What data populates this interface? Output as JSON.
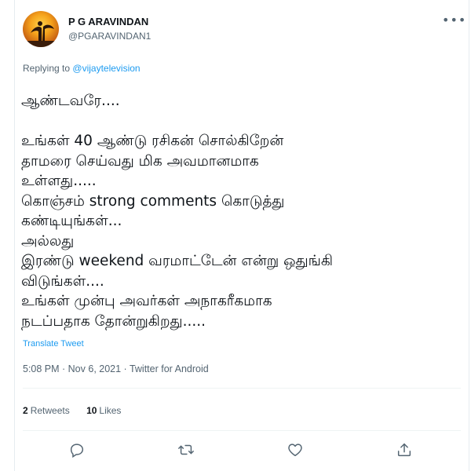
{
  "tweet": {
    "display_name": "P G ARAVINDAN",
    "handle": "@PGARAVINDAN1",
    "more_icon": "more-horizontal-icon",
    "reply_prefix": "Replying to",
    "reply_to": "@vijaytelevision",
    "text_lines": [
      "ஆண்டவரே....",
      "",
      "உங்கள் 40 ஆண்டு ரசிகன் சொல்கிறேன்",
      "தாமரை செய்வது மிக அவமானமாக",
      "உள்ளது.....",
      "கொஞ்சம் strong comments கொடுத்து",
      "கண்டியுங்கள்...",
      "அல்லது",
      "இரண்டு weekend வரமாட்டேன் என்று ஒதுங்கி",
      "விடுங்கள்....",
      "உங்கள் முன்பு அவர்கள் அநாகரீகமாக",
      "நடப்பதாக தோன்றுகிறது....."
    ],
    "translate_label": "Translate Tweet",
    "timestamp_line": "5:08 PM · Nov 6, 2021 · Twitter for Android",
    "retweets_count": "2",
    "retweets_label": "Retweets",
    "likes_count": "10",
    "likes_label": "Likes",
    "actions": [
      "reply-icon",
      "retweet-icon",
      "like-icon",
      "share-icon"
    ],
    "colors": {
      "link": "#1d9bf0",
      "secondary": "#536471",
      "primary": "#0f1419"
    }
  }
}
